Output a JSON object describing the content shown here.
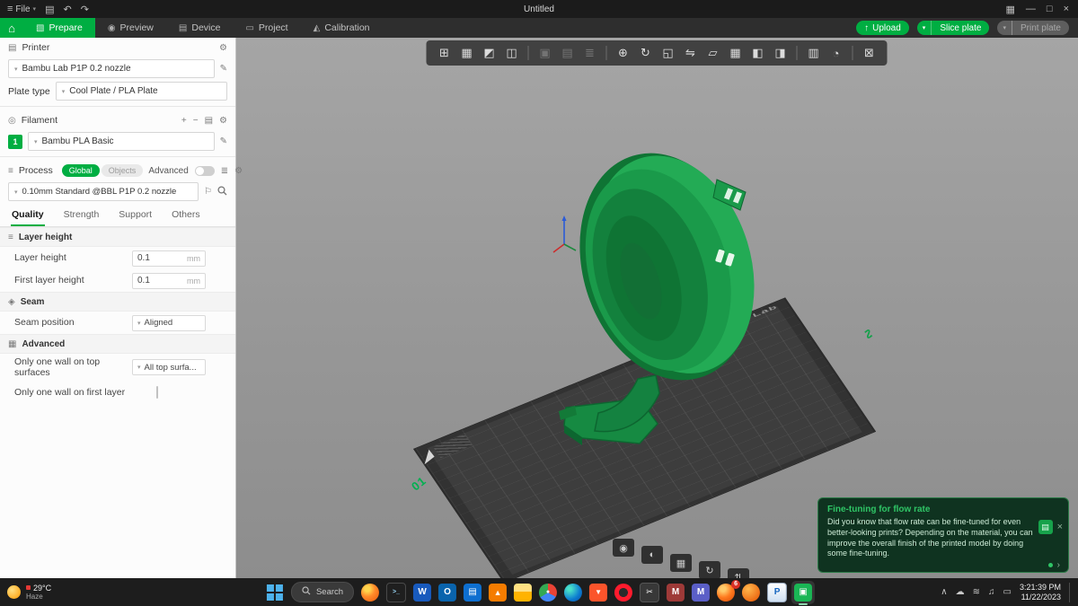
{
  "titlebar": {
    "file_menu": "File",
    "title": "Untitled"
  },
  "ribbon": {
    "tabs": [
      {
        "name": "tab-prepare",
        "label": "Prepare",
        "glyph": "▧",
        "cls": "active"
      },
      {
        "name": "tab-preview",
        "label": "Preview",
        "glyph": "◉",
        "cls": ""
      },
      {
        "name": "tab-device",
        "label": "Device",
        "glyph": "▤",
        "cls": ""
      },
      {
        "name": "tab-project",
        "label": "Project",
        "glyph": "▭",
        "cls": ""
      },
      {
        "name": "tab-calibration",
        "label": "Calibration",
        "glyph": "◭",
        "cls": ""
      }
    ],
    "upload_label": "Upload",
    "slice_label": "Slice plate",
    "print_label": "Print plate"
  },
  "sidebar": {
    "printer": {
      "title": "Printer",
      "value": "Bambu Lab P1P 0.2 nozzle",
      "plate_label": "Plate type",
      "plate_value": "Cool Plate / PLA Plate"
    },
    "filament": {
      "title": "Filament",
      "slot": "1",
      "value": "Bambu PLA Basic"
    },
    "process": {
      "title": "Process",
      "global_label": "Global",
      "objects_label": "Objects",
      "advanced_label": "Advanced",
      "preset": "0.10mm Standard @BBL P1P 0.2 nozzle"
    },
    "tabs": [
      {
        "name": "tab-quality",
        "label": "Quality",
        "cls": "active"
      },
      {
        "name": "tab-strength",
        "label": "Strength",
        "cls": ""
      },
      {
        "name": "tab-support",
        "label": "Support",
        "cls": ""
      },
      {
        "name": "tab-others",
        "label": "Others",
        "cls": ""
      }
    ],
    "layer": {
      "title": "Layer height",
      "row1_label": "Layer height",
      "row1_value": "0.1",
      "row1_unit": "mm",
      "row2_label": "First layer height",
      "row2_value": "0.1",
      "row2_unit": "mm"
    },
    "seam": {
      "title": "Seam",
      "row_label": "Seam position",
      "row_value": "Aligned"
    },
    "advanced": {
      "title": "Advanced",
      "row1_label": "Only one wall on top surfaces",
      "row1_value": "All top surfa...",
      "row2_label": "Only one wall on first layer"
    }
  },
  "viewport": {
    "toolbar": [
      {
        "name": "add-object-icon",
        "glyph": "⊞",
        "cls": "",
        "inter": "true"
      },
      {
        "name": "add-plate-icon",
        "glyph": "▦",
        "cls": "",
        "inter": "true"
      },
      {
        "name": "auto-orient-icon",
        "glyph": "◩",
        "cls": "",
        "inter": "true"
      },
      {
        "name": "split-model-icon",
        "glyph": "◫",
        "cls": "",
        "inter": "true"
      },
      {
        "name": "toolbar-divider",
        "glyph": "",
        "cls": "divider",
        "inter": "false"
      },
      {
        "name": "color-painting-icon",
        "glyph": "▣",
        "cls": "disabled",
        "inter": "true"
      },
      {
        "name": "support-painting-icon",
        "glyph": "▤",
        "cls": "disabled",
        "inter": "true"
      },
      {
        "name": "text-tool-icon",
        "glyph": "≣",
        "cls": "disabled",
        "inter": "true"
      },
      {
        "name": "toolbar-divider",
        "glyph": "",
        "cls": "divider",
        "inter": "false"
      },
      {
        "name": "move-icon",
        "glyph": "⊕",
        "cls": "",
        "inter": "true"
      },
      {
        "name": "rotate-icon",
        "glyph": "↻",
        "cls": "",
        "inter": "true"
      },
      {
        "name": "scale-icon",
        "glyph": "◱",
        "cls": "",
        "inter": "true"
      },
      {
        "name": "mirror-icon",
        "glyph": "⇋",
        "cls": "",
        "inter": "true"
      },
      {
        "name": "lay-on-face-icon",
        "glyph": "▱",
        "cls": "",
        "inter": "true"
      },
      {
        "name": "arrange-icon",
        "glyph": "▦",
        "cls": "",
        "inter": "true"
      },
      {
        "name": "split-to-objects-icon",
        "glyph": "◧",
        "cls": "",
        "inter": "true"
      },
      {
        "name": "split-to-parts-icon",
        "glyph": "◨",
        "cls": "",
        "inter": "true"
      },
      {
        "name": "toolbar-divider",
        "glyph": "",
        "cls": "divider",
        "inter": "false"
      },
      {
        "name": "variable-layer-height-icon",
        "glyph": "▥",
        "cls": "",
        "inter": "true"
      },
      {
        "name": "timelapse-icon",
        "glyph": "◔",
        "cls": "",
        "inter": "true"
      },
      {
        "name": "toolbar-divider",
        "glyph": "",
        "cls": "divider",
        "inter": "false"
      },
      {
        "name": "assembly-view-icon",
        "glyph": "⊠",
        "cls": "",
        "inter": "true"
      }
    ],
    "plate": {
      "brand": "Bambu Lab",
      "corner": "01"
    },
    "plate_buttons": [
      {
        "name": "plate-camera-icon",
        "glyph": "◉",
        "css": "left:420px;top:558px;"
      },
      {
        "name": "plate-shade-icon",
        "glyph": "◐",
        "css": "left:452px;top:566px;"
      },
      {
        "name": "plate-grid-icon",
        "glyph": "▦",
        "css": "left:484px;top:575px;"
      },
      {
        "name": "plate-refresh-icon",
        "glyph": "↻",
        "css": "left:516px;top:583px;"
      },
      {
        "name": "plate-updown-icon",
        "glyph": "⇅",
        "css": "left:548px;top:591px;"
      }
    ],
    "toast": {
      "title": "Fine-tuning for flow rate",
      "body": "Did you know that flow rate can be fine-tuned for even better-looking prints? Depending on the material, you can improve the overall finish of the printed model by doing some fine-tuning.",
      "next": "›"
    }
  },
  "taskbar": {
    "weather": {
      "temp": "29°C",
      "desc": "Haze"
    },
    "search_label": "Search",
    "apps": [
      {
        "name": "firefox",
        "glyph": "",
        "badge": "",
        "cls": "",
        "css": "background:radial-gradient(circle at 35% 30%,#ffd54d 15%,#ff8a2a 45%,#e8590c);border-radius:50%;"
      },
      {
        "name": "terminal",
        "glyph": ">_",
        "badge": "",
        "cls": "",
        "css": "background:#1f1f1f;border:1px solid #4a4a4a;color:#9cdcfe;font-size:7px;"
      },
      {
        "name": "word",
        "glyph": "W",
        "badge": "",
        "cls": "",
        "css": "background:#185abd;"
      },
      {
        "name": "outlook",
        "glyph": "O",
        "badge": "",
        "cls": "",
        "css": "background:#0a64ad;"
      },
      {
        "name": "microsoft-store",
        "glyph": "▤",
        "badge": "",
        "cls": "",
        "css": "background:#0e6fd0;"
      },
      {
        "name": "vlc",
        "glyph": "▲",
        "badge": "",
        "cls": "",
        "css": "background:#f57c00;font-size:9px;"
      },
      {
        "name": "file-explorer",
        "glyph": "",
        "badge": "",
        "cls": "",
        "css": "background:linear-gradient(180deg,#ffe082 45%,#ffb300 45%);"
      },
      {
        "name": "chrome",
        "glyph": "●",
        "badge": "",
        "cls": "",
        "css": "background:conic-gradient(#ea4335 0 33%,#4285f4 33% 66%,#34a853 66% 100%);border-radius:50%;color:#fff;font-size:7px;"
      },
      {
        "name": "edge",
        "glyph": "",
        "badge": "",
        "cls": "",
        "css": "background:radial-gradient(circle at 30% 30%,#49e0c8 10%,#0c7bd0 60%,#0a4f9e);border-radius:50%;"
      },
      {
        "name": "brave",
        "glyph": "▼",
        "badge": "",
        "cls": "",
        "css": "background:#fb542b;font-size:8px;"
      },
      {
        "name": "opera",
        "glyph": "",
        "badge": "",
        "cls": "",
        "css": "background:radial-gradient(circle,#2b2b2b 35%,#ff1b2d 36%);border-radius:50%;"
      },
      {
        "name": "snipping-tool",
        "glyph": "✂",
        "badge": "",
        "cls": "",
        "css": "background:#383838;border:1px solid #555;font-size:9px;"
      },
      {
        "name": "m-app-maroon",
        "glyph": "M",
        "badge": "",
        "cls": "",
        "css": "background:#9e3a38;"
      },
      {
        "name": "teams",
        "glyph": "M",
        "badge": "",
        "cls": "",
        "css": "background:#5b5fc7;"
      },
      {
        "name": "firefox-developer",
        "glyph": "",
        "badge": "6",
        "cls": "",
        "css": "background:radial-gradient(circle at 35% 30%,#ffca6a 15%,#ff7a1f 50%,#d84a05);border-radius:50%;"
      },
      {
        "name": "firefox-nightly",
        "glyph": "",
        "badge": "",
        "cls": "",
        "css": "background:radial-gradient(circle at 35% 30%,#ffb74d,#e65100);border-radius:50%;"
      },
      {
        "name": "paint",
        "glyph": "P",
        "badge": "",
        "cls": "",
        "css": "background:linear-gradient(#ffffff,#cfe0f2);border:1px solid #9aabc0;color:#1565c0;"
      },
      {
        "name": "bambu-studio",
        "glyph": "▣",
        "badge": "",
        "cls": "active",
        "css": "background:#00ae42;"
      }
    ],
    "tray": [
      {
        "name": "hidden-icons-chevron",
        "glyph": "∧"
      },
      {
        "name": "onedrive-icon",
        "glyph": "☁"
      },
      {
        "name": "wifi-icon",
        "glyph": "≋"
      },
      {
        "name": "volume-icon",
        "glyph": "♫"
      },
      {
        "name": "battery-icon",
        "glyph": "▭"
      }
    ],
    "clock": {
      "time": "3:21:39 PM",
      "date": "11/22/2023"
    }
  },
  "icons": {
    "file_chevron": "▾",
    "export": "▤",
    "undo": "↶",
    "redo": "↷",
    "layout": "▦",
    "minimize": "—",
    "maximize": "□",
    "close": "×",
    "home": "⌂",
    "upload": "↑",
    "chevron_small": "▾",
    "printer": "▤",
    "gear": "⚙",
    "edit": "✎",
    "plus": "+",
    "minus": "−",
    "filament": "◎",
    "sync": "⇅",
    "process": "≡",
    "param_table": "≣",
    "flag": "⚐",
    "layer_group": "≡",
    "seam_group": "◈",
    "advanced_group": "▦",
    "dropdown": "▾",
    "squiggle": "∿",
    "toast_flow": "▤",
    "toast_close": "×"
  }
}
